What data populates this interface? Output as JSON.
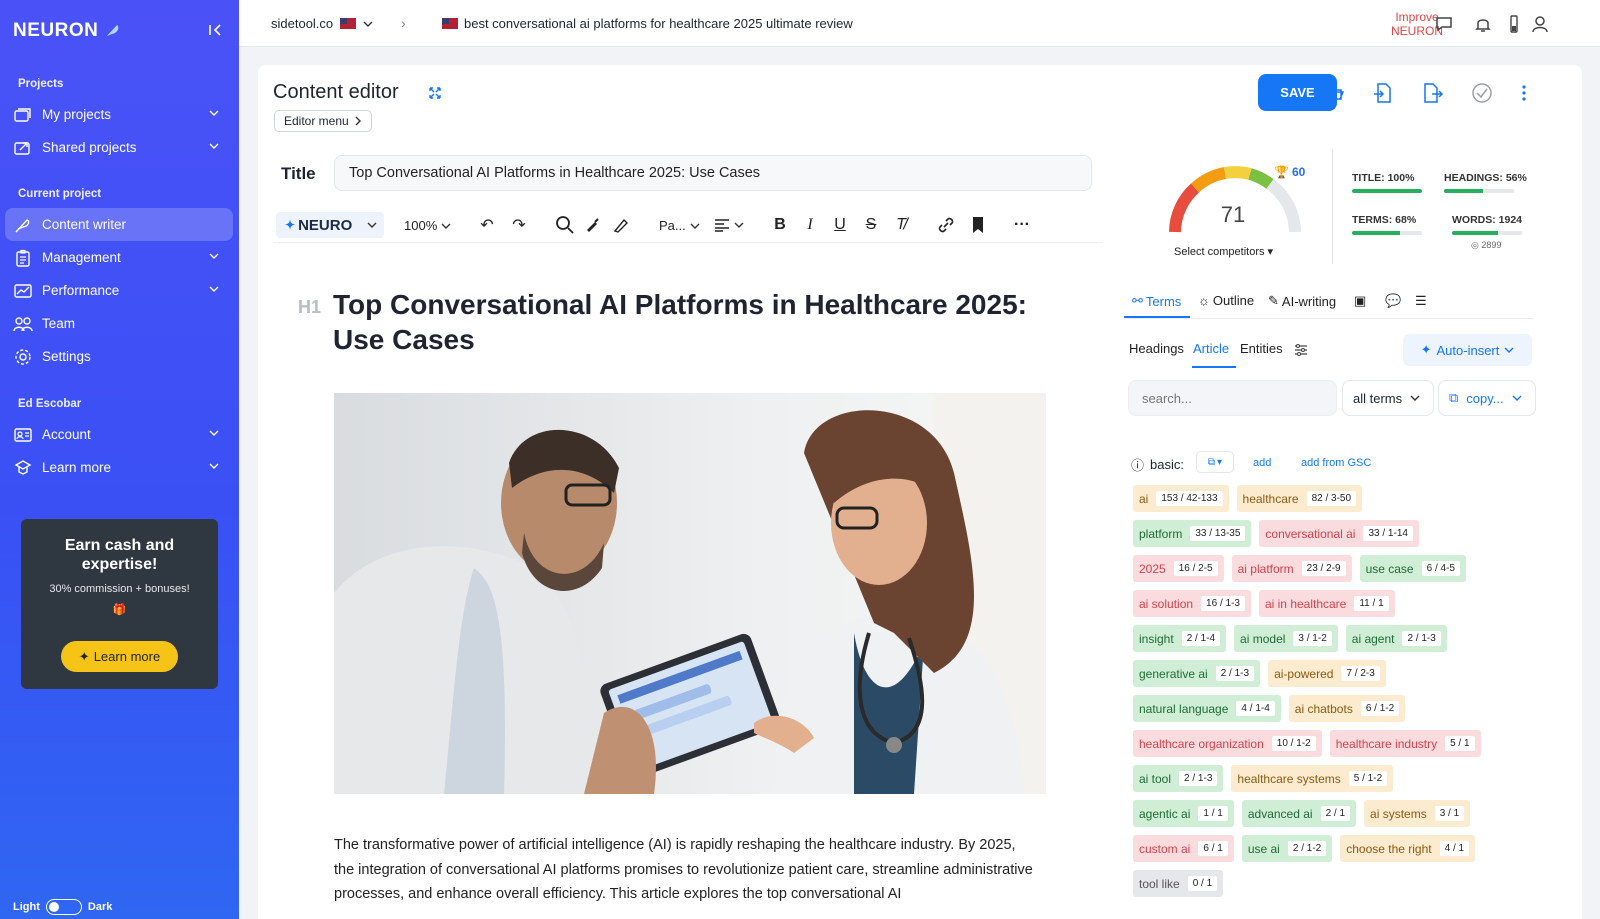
{
  "brand": "NEURON",
  "sidebar": {
    "sections": [
      "Projects",
      "Current project",
      "Ed Escobar"
    ],
    "items": [
      {
        "label": "My projects",
        "icon": "folders-icon",
        "chevron": true
      },
      {
        "label": "Shared projects",
        "icon": "share-icon",
        "chevron": true
      },
      {
        "label": "Content writer",
        "icon": "feather-icon",
        "chevron": false,
        "active": true
      },
      {
        "label": "Management",
        "icon": "clipboard-icon",
        "chevron": true
      },
      {
        "label": "Performance",
        "icon": "chart-icon",
        "chevron": true
      },
      {
        "label": "Team",
        "icon": "team-icon",
        "chevron": false
      },
      {
        "label": "Settings",
        "icon": "gear-icon",
        "chevron": false
      },
      {
        "label": "Account",
        "icon": "account-card-icon",
        "chevron": true
      },
      {
        "label": "Learn more",
        "icon": "graduation-icon",
        "chevron": true
      }
    ],
    "promo": {
      "title": "Earn cash and expertise!",
      "subtitle": "30% commission + bonuses!",
      "gift": "🎁",
      "button": "Learn more"
    },
    "theme": {
      "light": "Light",
      "dark": "Dark"
    }
  },
  "topbar": {
    "site": "sidetool.co",
    "query": "best conversational ai platforms for healthcare 2025 ultimate review",
    "improve_line1": "Improve",
    "improve_line2": "NEURON"
  },
  "editor": {
    "heading": "Content editor",
    "menu_label": "Editor menu",
    "save_label": "SAVE",
    "title_label": "Title",
    "title_value": "Top Conversational AI Platforms in Healthcare 2025: Use Cases",
    "toolbar": {
      "neuro": "NEURO",
      "zoom": "100%",
      "paragraph": "Pa..."
    },
    "h1_tag": "H1",
    "h1_text": "Top Conversational AI Platforms in Healthcare 2025: Use Cases",
    "paragraph": "The transformative power of artificial intelligence (AI) is rapidly reshaping the healthcare industry. By 2025, the integration of conversational AI platforms promises to revolutionize patient care, streamline administrative processes, and enhance overall efficiency. This article explores the top conversational AI"
  },
  "score": {
    "value": "71",
    "target": "60",
    "competitors_label": "Select competitors",
    "metrics": [
      {
        "label": "TITLE: 100%",
        "fill": 1.0
      },
      {
        "label": "HEADINGS: 56%",
        "fill": 0.56
      },
      {
        "label": "TERMS: 68%",
        "fill": 0.68
      },
      {
        "label": "WORDS: 1924",
        "fill": 0.66
      }
    ],
    "words_target": "2899"
  },
  "panel": {
    "tabs": [
      "Terms",
      "Outline",
      "AI-writing"
    ],
    "subtabs": [
      "Headings",
      "Article",
      "Entities"
    ],
    "autoinsert": "Auto-insert",
    "search_placeholder": "search...",
    "filter": "all terms",
    "copy": "copy...",
    "basic_label": "basic:",
    "add": "add",
    "add_gsc": "add from GSC"
  },
  "terms": [
    [
      {
        "t": "ai",
        "c": "153 / 42-133",
        "k": "orange"
      },
      {
        "t": "healthcare",
        "c": "82 / 3-50",
        "k": "orange"
      }
    ],
    [
      {
        "t": "platform",
        "c": "33 / 13-35",
        "k": "green"
      },
      {
        "t": "conversational ai",
        "c": "33 / 1-14",
        "k": "red"
      }
    ],
    [
      {
        "t": "2025",
        "c": "16 / 2-5",
        "k": "red"
      },
      {
        "t": "ai platform",
        "c": "23 / 2-9",
        "k": "red"
      },
      {
        "t": "use case",
        "c": "6 / 4-5",
        "k": "green"
      }
    ],
    [
      {
        "t": "ai solution",
        "c": "16 / 1-3",
        "k": "red"
      },
      {
        "t": "ai in healthcare",
        "c": "11 / 1",
        "k": "red"
      }
    ],
    [
      {
        "t": "insight",
        "c": "2 / 1-4",
        "k": "green"
      },
      {
        "t": "ai model",
        "c": "3 / 1-2",
        "k": "green"
      },
      {
        "t": "ai agent",
        "c": "2 / 1-3",
        "k": "green"
      }
    ],
    [
      {
        "t": "generative ai",
        "c": "2 / 1-3",
        "k": "green"
      },
      {
        "t": "ai-powered",
        "c": "7 / 2-3",
        "k": "orange"
      }
    ],
    [
      {
        "t": "natural language",
        "c": "4 / 1-4",
        "k": "green"
      },
      {
        "t": "ai chatbots",
        "c": "6 / 1-2",
        "k": "orange"
      }
    ],
    [
      {
        "t": "healthcare organization",
        "c": "10 / 1-2",
        "k": "red"
      },
      {
        "t": "healthcare industry",
        "c": "5 / 1",
        "k": "red"
      }
    ],
    [
      {
        "t": "ai tool",
        "c": "2 / 1-3",
        "k": "green"
      },
      {
        "t": "healthcare systems",
        "c": "5 / 1-2",
        "k": "orange"
      }
    ],
    [
      {
        "t": "agentic ai",
        "c": "1 / 1",
        "k": "green"
      },
      {
        "t": "advanced ai",
        "c": "2 / 1",
        "k": "green"
      },
      {
        "t": "ai systems",
        "c": "3 / 1",
        "k": "orange"
      }
    ],
    [
      {
        "t": "custom ai",
        "c": "6 / 1",
        "k": "red"
      },
      {
        "t": "use ai",
        "c": "2 / 1-2",
        "k": "green"
      },
      {
        "t": "choose the right",
        "c": "4 / 1",
        "k": "orange"
      }
    ],
    [
      {
        "t": "tool like",
        "c": "0 / 1",
        "k": "gray"
      }
    ]
  ]
}
